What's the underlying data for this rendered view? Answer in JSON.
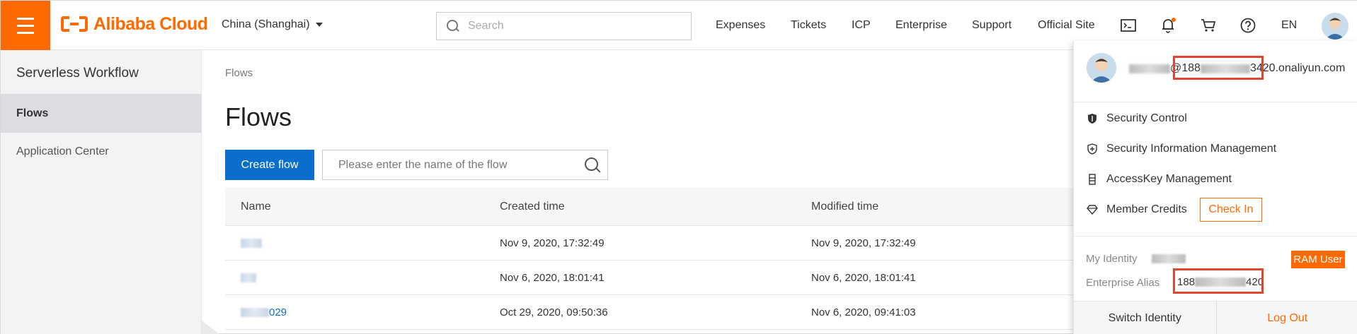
{
  "topbar": {
    "brand": "Alibaba Cloud",
    "region": "China (Shanghai)",
    "search_placeholder": "Search",
    "links": [
      "Expenses",
      "Tickets",
      "ICP",
      "Enterprise",
      "Support",
      "Official Site"
    ],
    "language": "EN",
    "icons": [
      "terminal-icon",
      "bell-icon",
      "cart-icon",
      "help-icon"
    ]
  },
  "sidebar": {
    "title": "Serverless Workflow",
    "items": [
      {
        "label": "Flows",
        "active": true
      },
      {
        "label": "Application Center",
        "active": false
      }
    ]
  },
  "main": {
    "breadcrumb": "Flows",
    "title": "Flows",
    "create_label": "Create flow",
    "search_placeholder": "Please enter the name of the flow",
    "columns": [
      "Name",
      "Created time",
      "Modified time"
    ],
    "rows": [
      {
        "name_suffix": "",
        "created": "Nov 9, 2020, 17:32:49",
        "modified": "Nov 9, 2020, 17:32:49"
      },
      {
        "name_suffix": "",
        "created": "Nov 6, 2020, 18:01:41",
        "modified": "Nov 6, 2020, 18:01:41"
      },
      {
        "name_suffix": "029",
        "created": "Oct 29, 2020, 09:50:36",
        "modified": "Nov 6, 2020, 09:41:03"
      }
    ]
  },
  "account_menu": {
    "email_at": "@",
    "email_prefix": "188",
    "email_suffix": "3420",
    "email_domain": ".onaliyun.com",
    "items": [
      {
        "label": "Security Control",
        "icon": "shield-icon"
      },
      {
        "label": "Security Information Management",
        "icon": "shield-plus-icon"
      },
      {
        "label": "AccessKey Management",
        "icon": "key-icon"
      },
      {
        "label": "Member Credits",
        "icon": "diamond-icon"
      }
    ],
    "check_in_label": "Check In",
    "identity_label": "My Identity",
    "identity_badge": "RAM User",
    "alias_label": "Enterprise Alias",
    "alias_prefix": "188",
    "alias_suffix": "420",
    "switch_label": "Switch Identity",
    "logout_label": "Log Out"
  },
  "colors": {
    "brand": "#ff6a00",
    "primary": "#0a6fcc",
    "highlight_box": "#e0472f"
  }
}
